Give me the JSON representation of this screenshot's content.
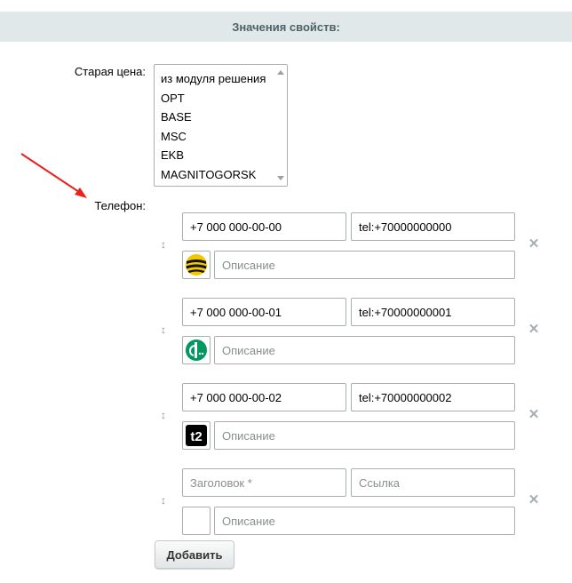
{
  "header": {
    "title": "Значения свойств:"
  },
  "old_price": {
    "label": "Старая цена:",
    "options": [
      "из модуля решения",
      "OPT",
      "BASE",
      "MSC",
      "EKB",
      "MAGNITOGORSK"
    ]
  },
  "phone": {
    "label": "Телефон:",
    "rows": [
      {
        "title": "+7 000 000-00-00",
        "link": "tel:+70000000000",
        "desc_placeholder": "Описание",
        "icon": "beeline-icon"
      },
      {
        "title": "+7 000 000-00-01",
        "link": "tel:+70000000001",
        "desc_placeholder": "Описание",
        "icon": "megafon-icon"
      },
      {
        "title": "+7 000 000-00-02",
        "link": "tel:+70000000002",
        "desc_placeholder": "Описание",
        "icon": "t2-icon"
      },
      {
        "title": "",
        "link": "",
        "title_placeholder": "Заголовок *",
        "link_placeholder": "Ссылка",
        "desc_placeholder": "Описание",
        "icon": ""
      }
    ],
    "drag_glyph": "↕",
    "remove_glyph": "✕"
  },
  "add_button": {
    "label": "Добавить"
  },
  "colors": {
    "header_bg": "#e0e8ea",
    "arrow": "#e8221e",
    "beeline": "#f4c800",
    "megafon": "#00985f",
    "t2": "#000000"
  }
}
